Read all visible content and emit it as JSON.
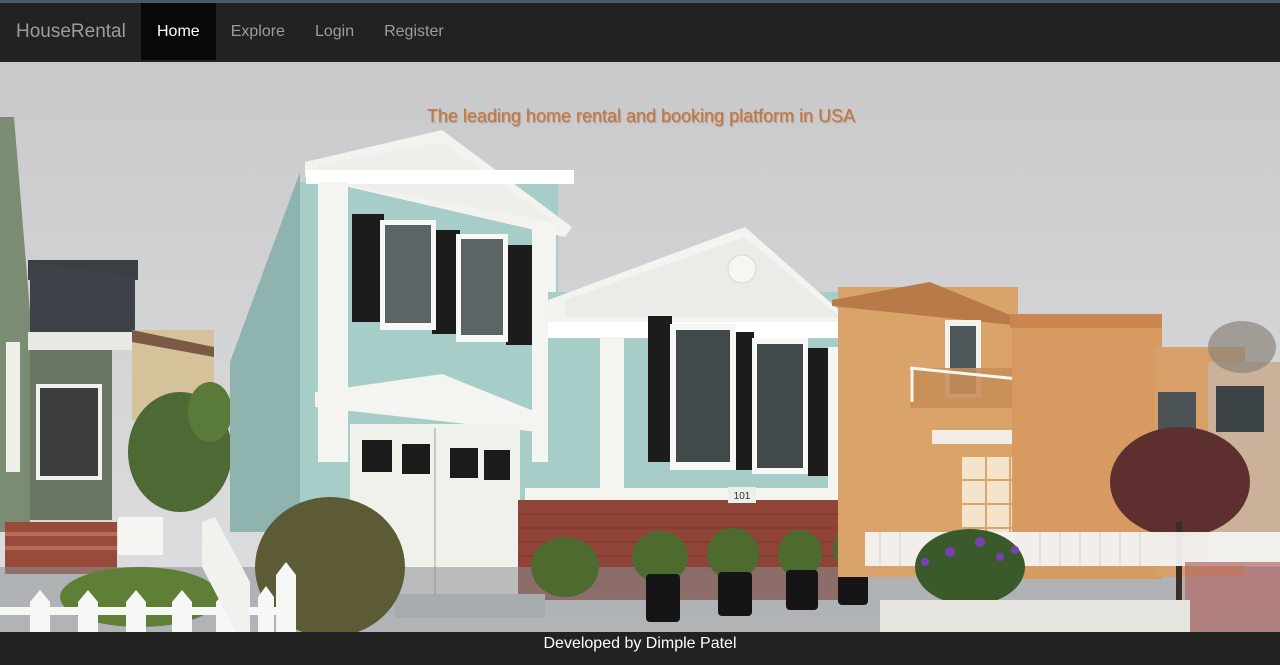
{
  "navbar": {
    "brand": "HouseRental",
    "items": [
      {
        "label": "Home",
        "active": true
      },
      {
        "label": "Explore",
        "active": false
      },
      {
        "label": "Login",
        "active": false
      },
      {
        "label": "Register",
        "active": false
      }
    ]
  },
  "hero": {
    "tagline": "The leading home rental and booking platform in USA",
    "house_number": "101"
  },
  "footer": {
    "text": "Developed by Dimple Patel"
  },
  "colors": {
    "navbar_bg": "#222222",
    "active_tab_bg": "#080808",
    "tagline": "#c8743a"
  }
}
